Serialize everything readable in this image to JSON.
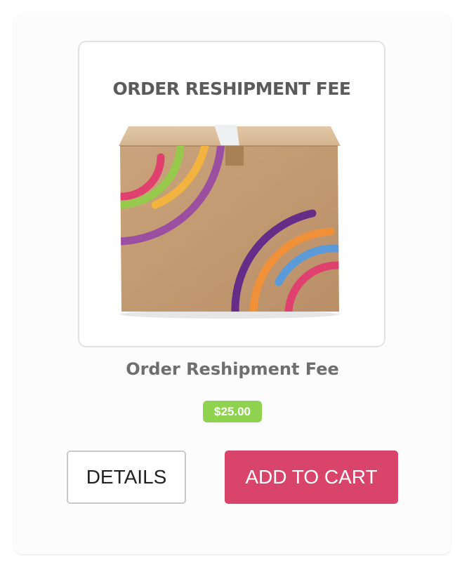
{
  "product": {
    "image_heading": "ORDER RESHIPMENT FEE",
    "title": "Order Reshipment Fee",
    "price": "$25.00"
  },
  "actions": {
    "details_label": "DETAILS",
    "add_to_cart_label": "ADD TO CART"
  },
  "colors": {
    "accent": "#d8446a",
    "price_badge": "#8fd24f",
    "title_text": "#6e6e6e"
  },
  "icons": {
    "product_image": "cardboard-box-illustration"
  }
}
